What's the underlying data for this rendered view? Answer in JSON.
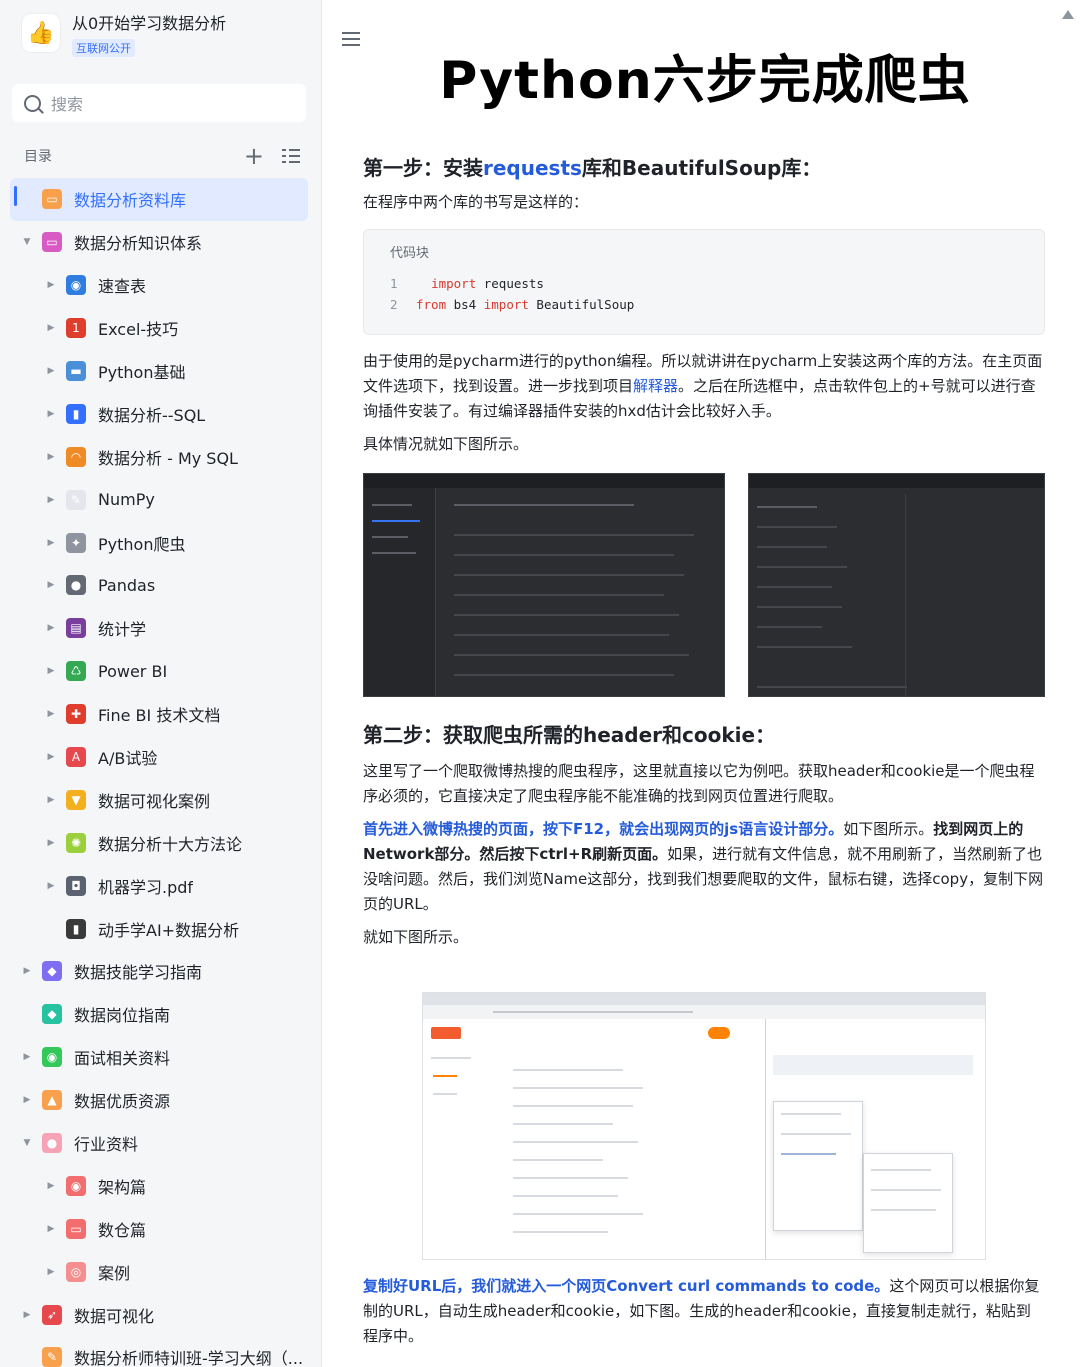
{
  "workspace": {
    "name": "从0开始学习数据分析",
    "badge": "互联网公开",
    "logo_icon": "thumbs-up-icon"
  },
  "search": {
    "placeholder": "搜索"
  },
  "toc": {
    "title": "目录"
  },
  "nav_items": [
    {
      "label": "数据分析资料库",
      "level": 0,
      "caret": "",
      "icon_color": "#f8a04b",
      "icon_glyph": "▭",
      "active": true
    },
    {
      "label": "数据分析知识体系",
      "level": 0,
      "caret": "▼",
      "icon_color": "#d85bc3",
      "icon_glyph": "▭"
    },
    {
      "label": "速查表",
      "level": 1,
      "caret": "▶",
      "icon_color": "#2f7de1",
      "icon_glyph": "◉"
    },
    {
      "label": "Excel-技巧",
      "level": 1,
      "caret": "▶",
      "icon_color": "#e03e2d",
      "icon_glyph": "1"
    },
    {
      "label": "Python基础",
      "level": 1,
      "caret": "▶",
      "icon_color": "#4a90d9",
      "icon_glyph": "▬"
    },
    {
      "label": "数据分析--SQL",
      "level": 1,
      "caret": "▶",
      "icon_color": "#3370ff",
      "icon_glyph": "▮"
    },
    {
      "label": "数据分析 - My SQL",
      "level": 1,
      "caret": "▶",
      "icon_color": "#f08a24",
      "icon_glyph": "◠"
    },
    {
      "label": "NumPy",
      "level": 1,
      "caret": "▶",
      "icon_color": "#e5e6eb",
      "icon_glyph": "✎"
    },
    {
      "label": "Python爬虫",
      "level": 1,
      "caret": "▶",
      "icon_color": "#8f959e",
      "icon_glyph": "✦"
    },
    {
      "label": "Pandas",
      "level": 1,
      "caret": "▶",
      "icon_color": "#646a73",
      "icon_glyph": "●"
    },
    {
      "label": "统计学",
      "level": 1,
      "caret": "▶",
      "icon_color": "#7a3e9d",
      "icon_glyph": "▤"
    },
    {
      "label": "Power BI",
      "level": 1,
      "caret": "▶",
      "icon_color": "#34a853",
      "icon_glyph": "♺"
    },
    {
      "label": "Fine BI 技术文档",
      "level": 1,
      "caret": "▶",
      "icon_color": "#e03e2d",
      "icon_glyph": "✚"
    },
    {
      "label": "A/B试验",
      "level": 1,
      "caret": "▶",
      "icon_color": "#e5484d",
      "icon_glyph": "A"
    },
    {
      "label": "数据可视化案例",
      "level": 1,
      "caret": "▶",
      "icon_color": "#f2b01e",
      "icon_glyph": "▼"
    },
    {
      "label": "数据分析十大方法论",
      "level": 1,
      "caret": "▶",
      "icon_color": "#9ccf3c",
      "icon_glyph": "✺"
    },
    {
      "label": "机器学习.pdf",
      "level": 1,
      "caret": "▶",
      "icon_color": "#5b6270",
      "icon_glyph": "◘"
    },
    {
      "label": "动手学AI+数据分析",
      "level": 1,
      "caret": "",
      "icon_color": "#3a3a3a",
      "icon_glyph": "▮"
    },
    {
      "label": "数据技能学习指南",
      "level": 0,
      "caret": "▶",
      "icon_color": "#7f6df2",
      "icon_glyph": "◆"
    },
    {
      "label": "数据岗位指南",
      "level": 0,
      "caret": "",
      "icon_color": "#27c2a0",
      "icon_glyph": "◆"
    },
    {
      "label": "面试相关资料",
      "level": 0,
      "caret": "▶",
      "icon_color": "#34c759",
      "icon_glyph": "◉"
    },
    {
      "label": "数据优质资源",
      "level": 0,
      "caret": "▶",
      "icon_color": "#f8a04b",
      "icon_glyph": "▲"
    },
    {
      "label": "行业资料",
      "level": 0,
      "caret": "▼",
      "icon_color": "#f5a3b5",
      "icon_glyph": "●"
    },
    {
      "label": "架构篇",
      "level": 1,
      "caret": "▶",
      "icon_color": "#f26d6d",
      "icon_glyph": "◉"
    },
    {
      "label": "数仓篇",
      "level": 1,
      "caret": "▶",
      "icon_color": "#f26d6d",
      "icon_glyph": "▭"
    },
    {
      "label": "案例",
      "level": 1,
      "caret": "▶",
      "icon_color": "#f58f8f",
      "icon_glyph": "◎"
    },
    {
      "label": "数据可视化",
      "level": 0,
      "caret": "▶",
      "icon_color": "#e5484d",
      "icon_glyph": "➶"
    },
    {
      "label": "数据分析师特训班-学习大纲（...",
      "level": 0,
      "caret": "",
      "icon_color": "#f8a04b",
      "icon_glyph": "✎"
    }
  ],
  "doc": {
    "title": "Python六步完成爬虫",
    "step1": {
      "heading_prefix": "第一步：安装",
      "heading_highlight": "requests",
      "heading_suffix": "库和BeautifulSoup库：",
      "intro": "在程序中两个库的书写是这样的：",
      "code_label": "代码块",
      "code_lines": [
        {
          "num": "1",
          "indent": "  ",
          "kw1": "import",
          "mid": " requests",
          "kw2": "",
          "tail": ""
        },
        {
          "num": "2",
          "indent": "",
          "kw1": "from",
          "mid": " bs4 ",
          "kw2": "import",
          "tail": " BeautifulSoup"
        }
      ],
      "para1_a": "由于使用的是pycharm进行的python编程。所以就讲讲在pycharm上安装这两个库的方法。在主页面文件选项下，找到设置。进一步找到项目",
      "para1_link": "解释器",
      "para1_b": "。之后在所选框中，点击软件包上的+号就可以进行查询插件安装了。有过编译器插件安装的hxd估计会比较好入手。",
      "para2": "具体情况就如下图所示。"
    },
    "step2": {
      "heading": "第二步：获取爬虫所需的header和cookie：",
      "para1": "这里写了一个爬取微博热搜的爬虫程序，这里就直接以它为例吧。获取header和cookie是一个爬虫程序必须的，它直接决定了爬虫程序能不能准确的找到网页位置进行爬取。",
      "para2_blue": "首先进入微博热搜的页面，按下F12，就会出现网页的js语言设计部分。",
      "para2_plain1": "如下图所示。",
      "para2_bold": "找到网页上的Network部分。然后按下ctrl+R刷新页面。",
      "para2_plain2": "如果，进行就有文件信息，就不用刷新了，当然刷新了也没啥问题。然后，我们浏览Name这部分，找到我们想要爬取的文件，鼠标右键，选择copy，复制下网页的URL。",
      "para3": "就如下图所示。",
      "para4_blue": "复制好URL后，我们就进入一个网页Convert curl commands to code。",
      "para4_plain": "这个网页可以根据你复制的URL，自动生成header和cookie，如下图。生成的header和cookie，直接复制走就行，粘贴到程序中。"
    }
  }
}
